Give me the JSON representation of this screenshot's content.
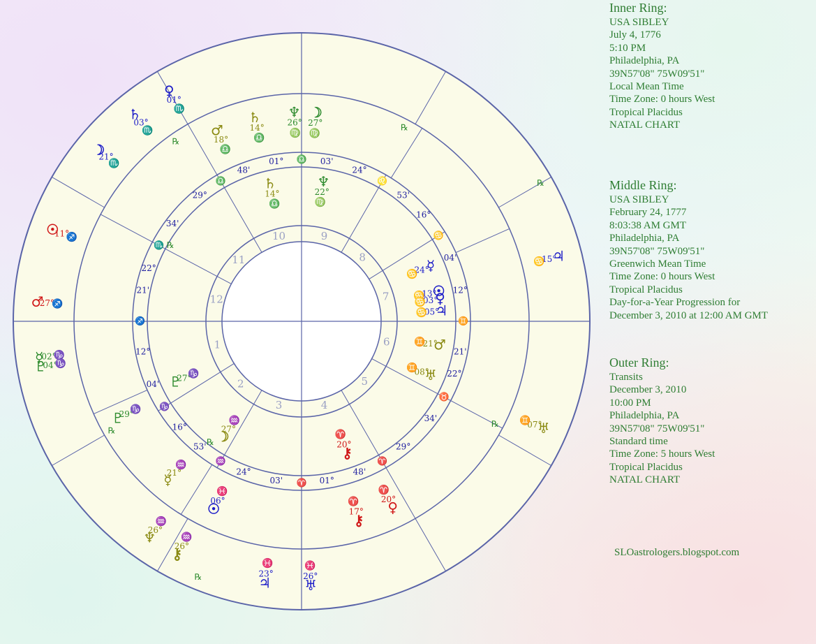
{
  "info_panels": {
    "inner": {
      "title": "Inner Ring:",
      "lines": [
        "USA SIBLEY",
        "July 4, 1776",
        "5:10 PM",
        "Philadelphia, PA",
        "39N57'08\"  75W09'51\"",
        "Local Mean Time",
        "Time Zone: 0 hours West",
        "Tropical Placidus",
        "NATAL CHART"
      ]
    },
    "middle": {
      "title": "Middle Ring:",
      "lines": [
        "USA SIBLEY",
        "February 24, 1777",
        "8:03:38 AM GMT",
        "Philadelphia, PA",
        "39N57'08\"  75W09'51\"",
        "Greenwich Mean Time",
        "Time Zone: 0 hours West",
        "Tropical Placidus",
        "Day-for-a-Year Progression  for",
        "December 3, 2010 at 12:00 AM GMT"
      ]
    },
    "outer": {
      "title": "Outer Ring:",
      "lines": [
        "Transits",
        "December 3, 2010",
        "10:00 PM",
        "Philadelphia, PA",
        "39N57'08\"  75W09'51\"",
        "Standard time",
        "Time Zone: 5 hours West",
        "Tropical Placidus",
        "NATAL CHART"
      ]
    }
  },
  "credit": "SLOastrologers.blogspot.com",
  "colors": {
    "ring_line": "#5a64a8",
    "wheel_fill": "#fbfbe8",
    "house_number": "#9aa0c4",
    "cusp_label": "#2020a0",
    "gold": "#8a8a12",
    "green": "#2e8b2e",
    "blue": "#1c1cc8",
    "red": "#d01818"
  },
  "chart": {
    "house_numbers": [
      "1",
      "2",
      "3",
      "4",
      "5",
      "6",
      "7",
      "8",
      "9",
      "10",
      "11",
      "12"
    ],
    "inner_cusps": [
      {
        "deg": "12°",
        "sign": "♐",
        "min": "21'"
      },
      {
        "deg": "16°",
        "sign": "♑",
        "min": "04'"
      },
      {
        "deg": "24°",
        "sign": "♒",
        "min": "53'"
      },
      {
        "deg": "01°",
        "sign": "♈",
        "min": "03'"
      },
      {
        "deg": "29°",
        "sign": "♈",
        "min": "48'"
      },
      {
        "deg": "22°",
        "sign": "♉",
        "min": "34'"
      },
      {
        "deg": "12°",
        "sign": "♊",
        "min": "21'"
      },
      {
        "deg": "16°",
        "sign": "♋",
        "min": "04'"
      },
      {
        "deg": "24°",
        "sign": "♌",
        "min": "53'"
      },
      {
        "deg": "01°",
        "sign": "♎",
        "min": "03'"
      },
      {
        "deg": "29°",
        "sign": "♎",
        "min": "48'"
      },
      {
        "deg": "22°",
        "sign": "♏",
        "min": "34'"
      }
    ],
    "planets": [
      {
        "ring": "inner",
        "glyph": "☉",
        "deg": "13°",
        "sign": "♋",
        "color": "blue"
      },
      {
        "ring": "inner",
        "glyph": "☿",
        "deg": "24°",
        "sign": "♋",
        "color": "blue"
      },
      {
        "ring": "inner",
        "glyph": "♃",
        "deg": "05°",
        "sign": "♋",
        "color": "blue"
      },
      {
        "ring": "inner",
        "glyph": "♀",
        "deg": "03°",
        "sign": "♋",
        "color": "blue"
      },
      {
        "ring": "inner",
        "glyph": "♂",
        "deg": "21°",
        "sign": "♊",
        "color": "gold"
      },
      {
        "ring": "inner",
        "glyph": "♅",
        "deg": "08°",
        "sign": "♊",
        "color": "gold"
      },
      {
        "ring": "inner",
        "glyph": "♄",
        "deg": "14°",
        "sign": "♎",
        "color": "gold"
      },
      {
        "ring": "inner",
        "glyph": "♆",
        "deg": "22°",
        "sign": "♍",
        "color": "green"
      },
      {
        "ring": "inner",
        "glyph": "☽",
        "deg": "27°",
        "sign": "♒",
        "color": "gold"
      },
      {
        "ring": "inner",
        "glyph": "⚷",
        "deg": "20°",
        "sign": "♈",
        "color": "red"
      },
      {
        "ring": "inner",
        "glyph": "♇",
        "deg": "27°",
        "sign": "♑",
        "color": "green"
      },
      {
        "ring": "middle",
        "glyph": "♄",
        "deg": "14°",
        "sign": "♎",
        "color": "gold"
      },
      {
        "ring": "middle",
        "glyph": "♂",
        "deg": "18°",
        "sign": "♎",
        "color": "gold"
      },
      {
        "ring": "middle",
        "glyph": "☽",
        "deg": "27°",
        "sign": "♍",
        "color": "green"
      },
      {
        "ring": "middle",
        "glyph": "♆",
        "deg": "26°",
        "sign": "♍",
        "color": "green"
      },
      {
        "ring": "middle",
        "glyph": "⚷",
        "deg": "17°",
        "sign": "♈",
        "color": "red"
      },
      {
        "ring": "middle",
        "glyph": "♀",
        "deg": "20°",
        "sign": "♈",
        "color": "red"
      },
      {
        "ring": "middle",
        "glyph": "☉",
        "deg": "06°",
        "sign": "♓",
        "color": "blue"
      },
      {
        "ring": "middle",
        "glyph": "☿",
        "deg": "21°",
        "sign": "♒",
        "color": "gold"
      },
      {
        "ring": "middle",
        "glyph": "♇",
        "deg": "29°",
        "sign": "♑",
        "color": "green"
      },
      {
        "ring": "outer",
        "glyph": "♀",
        "deg": "01°",
        "sign": "♏",
        "color": "blue"
      },
      {
        "ring": "outer",
        "glyph": "♄",
        "deg": "03°",
        "sign": "♏",
        "color": "blue"
      },
      {
        "ring": "outer",
        "glyph": "☽",
        "deg": "21°",
        "sign": "♏",
        "color": "blue"
      },
      {
        "ring": "outer",
        "glyph": "☉",
        "deg": "11°",
        "sign": "♐",
        "color": "red"
      },
      {
        "ring": "outer",
        "glyph": "♂",
        "deg": "27°",
        "sign": "♐",
        "color": "red"
      },
      {
        "ring": "outer",
        "glyph": "☿",
        "deg": "02°",
        "sign": "♑",
        "color": "green"
      },
      {
        "ring": "outer",
        "glyph": "♇",
        "deg": "04°",
        "sign": "♑",
        "color": "green"
      },
      {
        "ring": "outer",
        "glyph": "♆",
        "deg": "26°",
        "sign": "♒",
        "color": "gold"
      },
      {
        "ring": "outer",
        "glyph": "⚷",
        "deg": "26°",
        "sign": "♒",
        "color": "gold"
      },
      {
        "ring": "outer",
        "glyph": "♃",
        "deg": "23°",
        "sign": "♓",
        "color": "blue"
      },
      {
        "ring": "outer",
        "glyph": "♅",
        "deg": "26°",
        "sign": "♓",
        "color": "blue"
      },
      {
        "ring": "outer",
        "glyph": "♃",
        "deg": "15°",
        "sign": "♋",
        "color": "blue"
      },
      {
        "ring": "outer",
        "glyph": "♅",
        "deg": "07°",
        "sign": "♊",
        "color": "gold"
      }
    ],
    "retrograde_symbol": "℞"
  }
}
